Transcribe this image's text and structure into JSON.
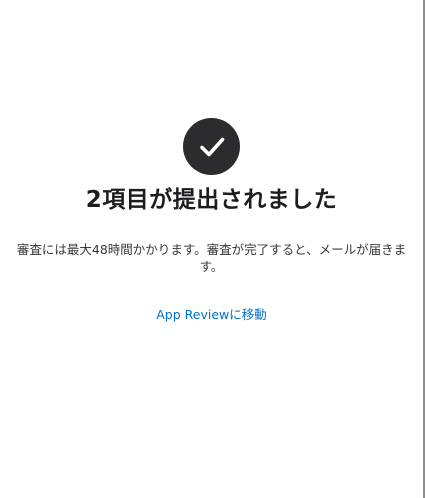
{
  "confirmation": {
    "icon": "checkmark-circle-icon",
    "icon_color": "#2c2c2e",
    "title": "2項目が提出されました",
    "message": "審査には最大48時間かかります。審査が完了すると、メールが届きます。",
    "link_label": "App Reviewに移動",
    "link_color": "#0070c9"
  }
}
